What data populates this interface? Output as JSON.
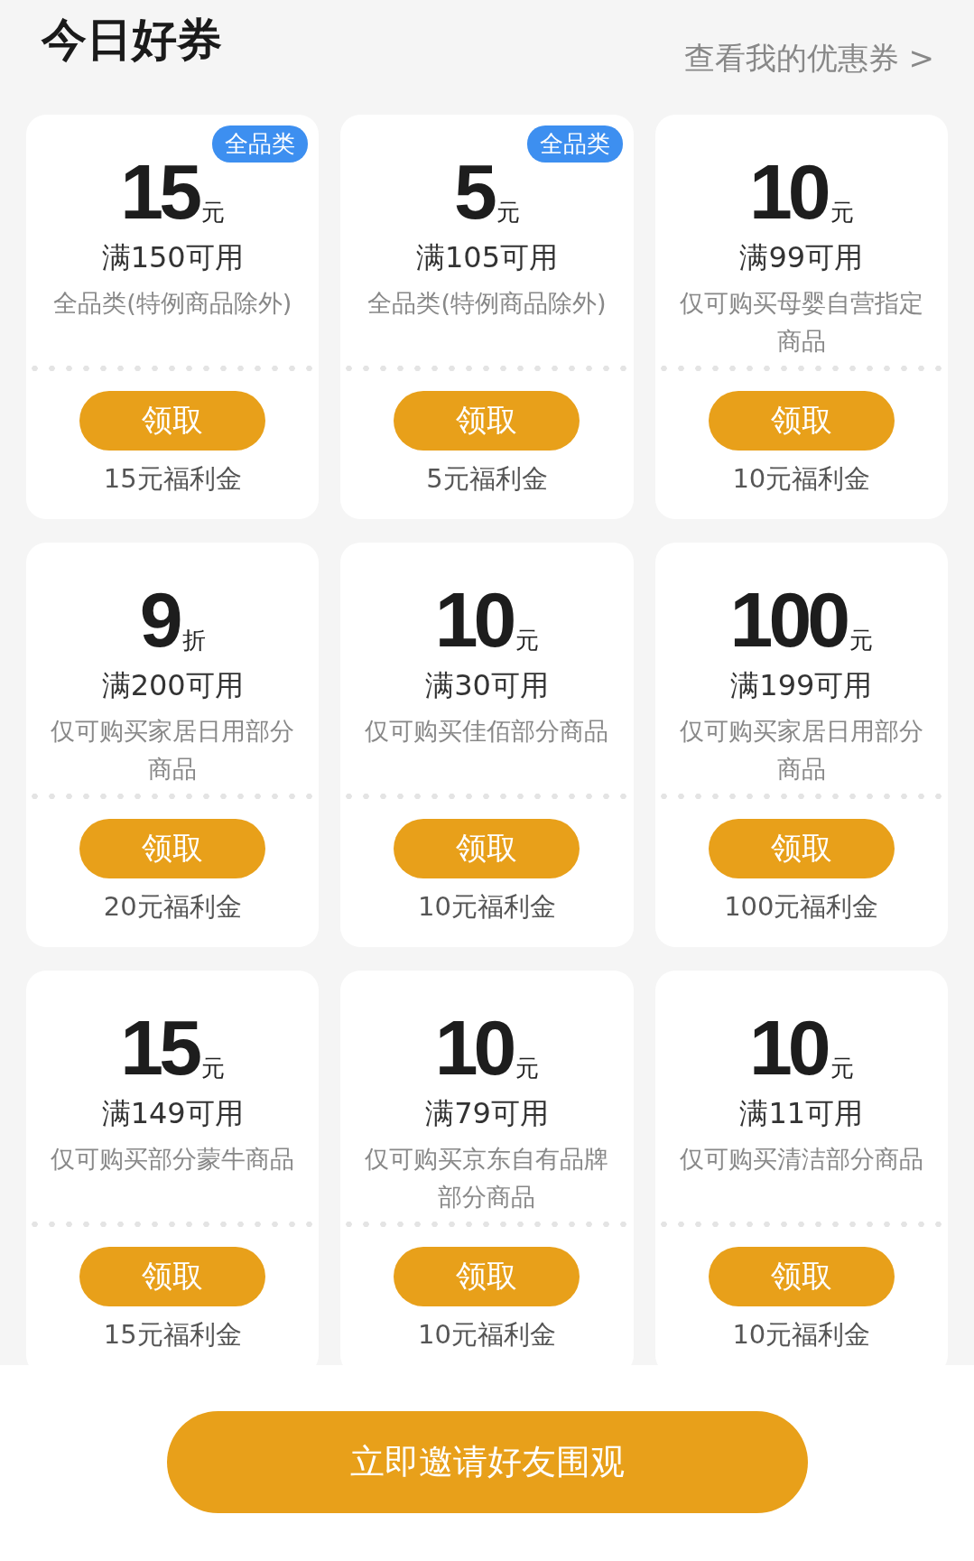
{
  "header": {
    "title": "今日好券",
    "link": "查看我的优惠券 >"
  },
  "coupons": [
    {
      "badge": "全品类",
      "amount": "15",
      "unit": "元",
      "condition": "满150可用",
      "description": "全品类(特例商品除外)",
      "button": "领取",
      "reward": "15元福利金"
    },
    {
      "badge": "全品类",
      "amount": "5",
      "unit": "元",
      "condition": "满105可用",
      "description": "全品类(特例商品除外)",
      "button": "领取",
      "reward": "5元福利金"
    },
    {
      "amount": "10",
      "unit": "元",
      "condition": "满99可用",
      "description": "仅可购买母婴自营指定商品",
      "button": "领取",
      "reward": "10元福利金"
    },
    {
      "amount": "9",
      "unit": "折",
      "condition": "满200可用",
      "description": "仅可购买家居日用部分商品",
      "button": "领取",
      "reward": "20元福利金"
    },
    {
      "amount": "10",
      "unit": "元",
      "condition": "满30可用",
      "description": "仅可购买佳佰部分商品",
      "button": "领取",
      "reward": "10元福利金"
    },
    {
      "amount": "100",
      "unit": "元",
      "condition": "满199可用",
      "description": "仅可购买家居日用部分商品",
      "button": "领取",
      "reward": "100元福利金"
    },
    {
      "amount": "15",
      "unit": "元",
      "condition": "满149可用",
      "description": "仅可购买部分蒙牛商品",
      "button": "领取",
      "reward": "15元福利金"
    },
    {
      "amount": "10",
      "unit": "元",
      "condition": "满79可用",
      "description": "仅可购买京东自有品牌部分商品",
      "button": "领取",
      "reward": "10元福利金"
    },
    {
      "amount": "10",
      "unit": "元",
      "condition": "满11可用",
      "description": "仅可购买清洁部分商品",
      "button": "领取",
      "reward": "10元福利金"
    }
  ],
  "invite_button": "立即邀请好友围观"
}
